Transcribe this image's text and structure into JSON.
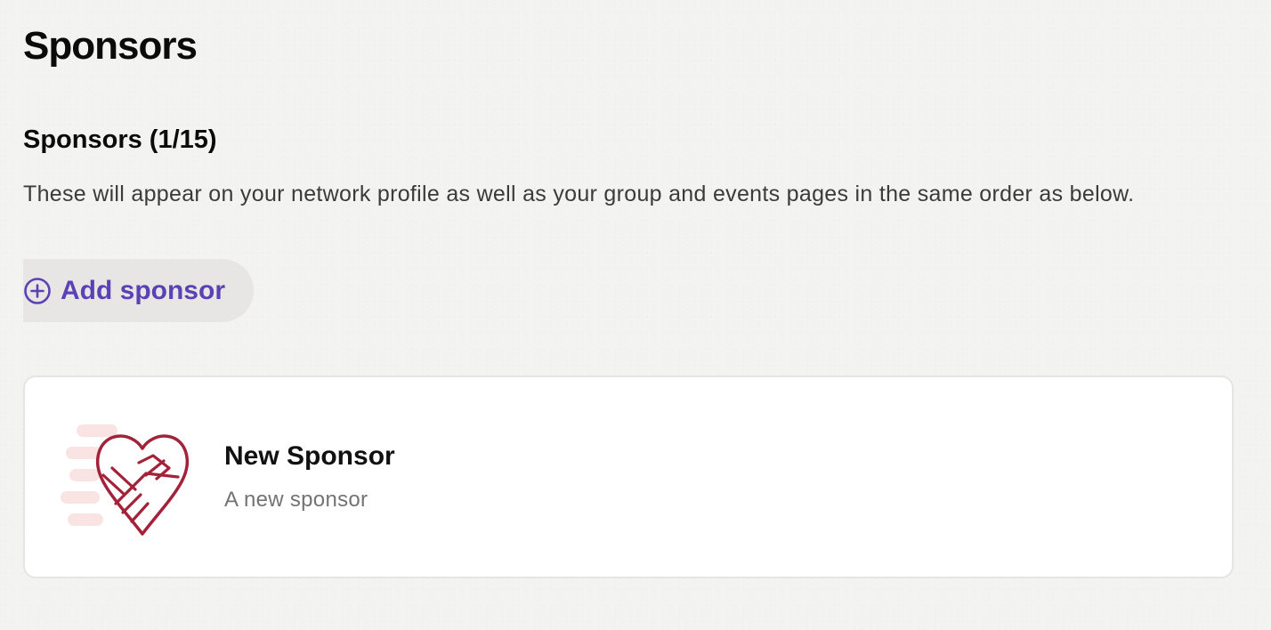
{
  "page": {
    "title": "Sponsors"
  },
  "section": {
    "heading": "Sponsors (1/15)",
    "description": "These will appear on your network profile as well as your group and events pages in the same order as below."
  },
  "add_button": {
    "label": "Add sponsor",
    "icon": "plus-circle-icon"
  },
  "sponsors": [
    {
      "name": "New Sponsor",
      "description": "A new sponsor",
      "logo_icon": "heart-handshake-icon"
    }
  ],
  "colors": {
    "accent": "#5a41b6",
    "logo": "#a3223a",
    "logo_light": "#f7dede",
    "card_border": "#e5e5e3",
    "background": "#f3f3f2"
  }
}
